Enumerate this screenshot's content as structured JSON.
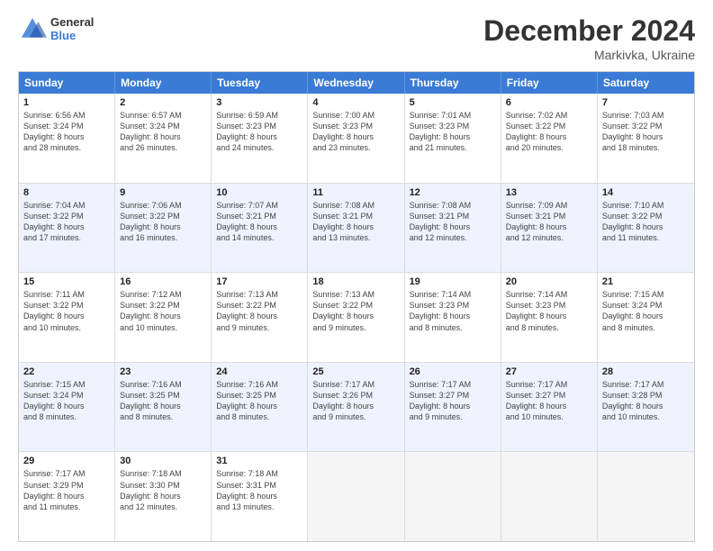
{
  "logo": {
    "line1": "General",
    "line2": "Blue"
  },
  "title": "December 2024",
  "subtitle": "Markivka, Ukraine",
  "header_days": [
    "Sunday",
    "Monday",
    "Tuesday",
    "Wednesday",
    "Thursday",
    "Friday",
    "Saturday"
  ],
  "rows": [
    {
      "alt": false,
      "cells": [
        {
          "day": "1",
          "lines": [
            "Sunrise: 6:56 AM",
            "Sunset: 3:24 PM",
            "Daylight: 8 hours",
            "and 28 minutes."
          ]
        },
        {
          "day": "2",
          "lines": [
            "Sunrise: 6:57 AM",
            "Sunset: 3:24 PM",
            "Daylight: 8 hours",
            "and 26 minutes."
          ]
        },
        {
          "day": "3",
          "lines": [
            "Sunrise: 6:59 AM",
            "Sunset: 3:23 PM",
            "Daylight: 8 hours",
            "and 24 minutes."
          ]
        },
        {
          "day": "4",
          "lines": [
            "Sunrise: 7:00 AM",
            "Sunset: 3:23 PM",
            "Daylight: 8 hours",
            "and 23 minutes."
          ]
        },
        {
          "day": "5",
          "lines": [
            "Sunrise: 7:01 AM",
            "Sunset: 3:23 PM",
            "Daylight: 8 hours",
            "and 21 minutes."
          ]
        },
        {
          "day": "6",
          "lines": [
            "Sunrise: 7:02 AM",
            "Sunset: 3:22 PM",
            "Daylight: 8 hours",
            "and 20 minutes."
          ]
        },
        {
          "day": "7",
          "lines": [
            "Sunrise: 7:03 AM",
            "Sunset: 3:22 PM",
            "Daylight: 8 hours",
            "and 18 minutes."
          ]
        }
      ]
    },
    {
      "alt": true,
      "cells": [
        {
          "day": "8",
          "lines": [
            "Sunrise: 7:04 AM",
            "Sunset: 3:22 PM",
            "Daylight: 8 hours",
            "and 17 minutes."
          ]
        },
        {
          "day": "9",
          "lines": [
            "Sunrise: 7:06 AM",
            "Sunset: 3:22 PM",
            "Daylight: 8 hours",
            "and 16 minutes."
          ]
        },
        {
          "day": "10",
          "lines": [
            "Sunrise: 7:07 AM",
            "Sunset: 3:21 PM",
            "Daylight: 8 hours",
            "and 14 minutes."
          ]
        },
        {
          "day": "11",
          "lines": [
            "Sunrise: 7:08 AM",
            "Sunset: 3:21 PM",
            "Daylight: 8 hours",
            "and 13 minutes."
          ]
        },
        {
          "day": "12",
          "lines": [
            "Sunrise: 7:08 AM",
            "Sunset: 3:21 PM",
            "Daylight: 8 hours",
            "and 12 minutes."
          ]
        },
        {
          "day": "13",
          "lines": [
            "Sunrise: 7:09 AM",
            "Sunset: 3:21 PM",
            "Daylight: 8 hours",
            "and 12 minutes."
          ]
        },
        {
          "day": "14",
          "lines": [
            "Sunrise: 7:10 AM",
            "Sunset: 3:22 PM",
            "Daylight: 8 hours",
            "and 11 minutes."
          ]
        }
      ]
    },
    {
      "alt": false,
      "cells": [
        {
          "day": "15",
          "lines": [
            "Sunrise: 7:11 AM",
            "Sunset: 3:22 PM",
            "Daylight: 8 hours",
            "and 10 minutes."
          ]
        },
        {
          "day": "16",
          "lines": [
            "Sunrise: 7:12 AM",
            "Sunset: 3:22 PM",
            "Daylight: 8 hours",
            "and 10 minutes."
          ]
        },
        {
          "day": "17",
          "lines": [
            "Sunrise: 7:13 AM",
            "Sunset: 3:22 PM",
            "Daylight: 8 hours",
            "and 9 minutes."
          ]
        },
        {
          "day": "18",
          "lines": [
            "Sunrise: 7:13 AM",
            "Sunset: 3:22 PM",
            "Daylight: 8 hours",
            "and 9 minutes."
          ]
        },
        {
          "day": "19",
          "lines": [
            "Sunrise: 7:14 AM",
            "Sunset: 3:23 PM",
            "Daylight: 8 hours",
            "and 8 minutes."
          ]
        },
        {
          "day": "20",
          "lines": [
            "Sunrise: 7:14 AM",
            "Sunset: 3:23 PM",
            "Daylight: 8 hours",
            "and 8 minutes."
          ]
        },
        {
          "day": "21",
          "lines": [
            "Sunrise: 7:15 AM",
            "Sunset: 3:24 PM",
            "Daylight: 8 hours",
            "and 8 minutes."
          ]
        }
      ]
    },
    {
      "alt": true,
      "cells": [
        {
          "day": "22",
          "lines": [
            "Sunrise: 7:15 AM",
            "Sunset: 3:24 PM",
            "Daylight: 8 hours",
            "and 8 minutes."
          ]
        },
        {
          "day": "23",
          "lines": [
            "Sunrise: 7:16 AM",
            "Sunset: 3:25 PM",
            "Daylight: 8 hours",
            "and 8 minutes."
          ]
        },
        {
          "day": "24",
          "lines": [
            "Sunrise: 7:16 AM",
            "Sunset: 3:25 PM",
            "Daylight: 8 hours",
            "and 8 minutes."
          ]
        },
        {
          "day": "25",
          "lines": [
            "Sunrise: 7:17 AM",
            "Sunset: 3:26 PM",
            "Daylight: 8 hours",
            "and 9 minutes."
          ]
        },
        {
          "day": "26",
          "lines": [
            "Sunrise: 7:17 AM",
            "Sunset: 3:27 PM",
            "Daylight: 8 hours",
            "and 9 minutes."
          ]
        },
        {
          "day": "27",
          "lines": [
            "Sunrise: 7:17 AM",
            "Sunset: 3:27 PM",
            "Daylight: 8 hours",
            "and 10 minutes."
          ]
        },
        {
          "day": "28",
          "lines": [
            "Sunrise: 7:17 AM",
            "Sunset: 3:28 PM",
            "Daylight: 8 hours",
            "and 10 minutes."
          ]
        }
      ]
    },
    {
      "alt": false,
      "cells": [
        {
          "day": "29",
          "lines": [
            "Sunrise: 7:17 AM",
            "Sunset: 3:29 PM",
            "Daylight: 8 hours",
            "and 11 minutes."
          ]
        },
        {
          "day": "30",
          "lines": [
            "Sunrise: 7:18 AM",
            "Sunset: 3:30 PM",
            "Daylight: 8 hours",
            "and 12 minutes."
          ]
        },
        {
          "day": "31",
          "lines": [
            "Sunrise: 7:18 AM",
            "Sunset: 3:31 PM",
            "Daylight: 8 hours",
            "and 13 minutes."
          ]
        },
        {
          "day": "",
          "lines": []
        },
        {
          "day": "",
          "lines": []
        },
        {
          "day": "",
          "lines": []
        },
        {
          "day": "",
          "lines": []
        }
      ]
    }
  ]
}
